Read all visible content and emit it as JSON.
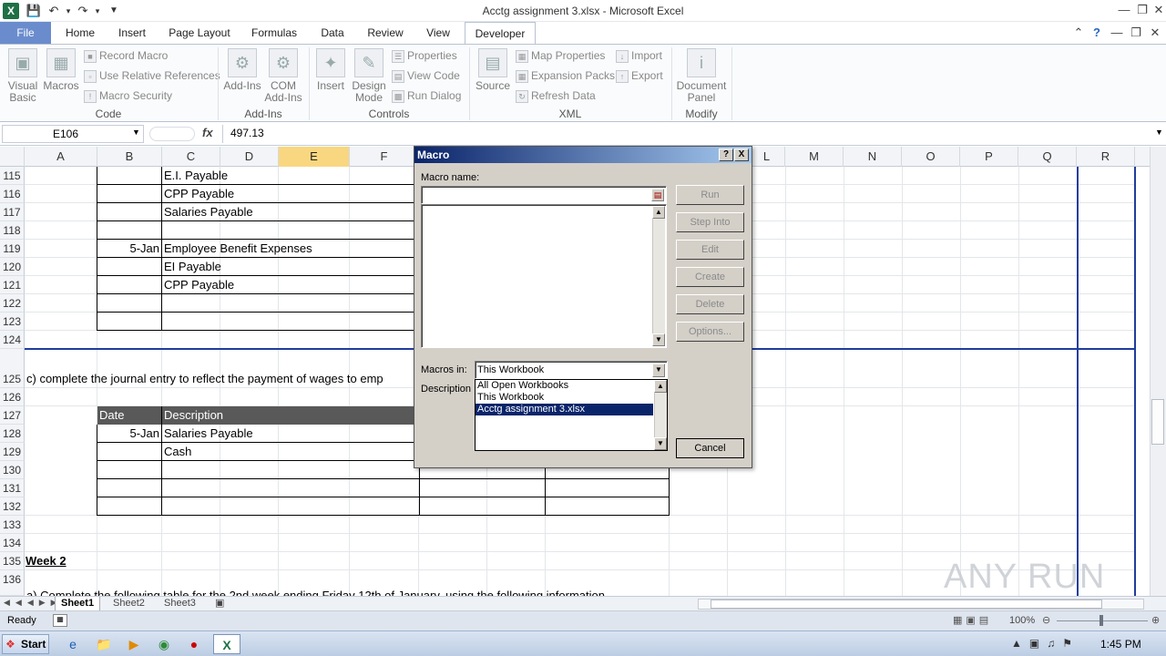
{
  "window": {
    "title": "Acctg assignment 3.xlsx - Microsoft Excel"
  },
  "ribbon": {
    "tabs": [
      "File",
      "Home",
      "Insert",
      "Page Layout",
      "Formulas",
      "Data",
      "Review",
      "View",
      "Developer"
    ],
    "active_tab": "Developer",
    "groups": {
      "code": {
        "label": "Code",
        "visual_basic": "Visual Basic",
        "macros": "Macros",
        "record_macro": "Record Macro",
        "use_relative": "Use Relative References",
        "macro_security": "Macro Security"
      },
      "addins": {
        "label": "Add-Ins",
        "addins": "Add-Ins",
        "com_addins": "COM Add-Ins"
      },
      "controls": {
        "label": "Controls",
        "insert": "Insert",
        "design_mode": "Design Mode",
        "properties": "Properties",
        "view_code": "View Code",
        "run_dialog": "Run Dialog"
      },
      "xml": {
        "label": "XML",
        "source": "Source",
        "map_properties": "Map Properties",
        "expansion_packs": "Expansion Packs",
        "refresh_data": "Refresh Data",
        "import": "Import",
        "export": "Export"
      },
      "modify": {
        "label": "Modify",
        "document_panel": "Document Panel"
      }
    }
  },
  "formula_bar": {
    "name_box": "E106",
    "fx": "fx",
    "value": "497.13"
  },
  "grid": {
    "columns": [
      "A",
      "B",
      "C",
      "D",
      "E",
      "F",
      "L",
      "M",
      "N",
      "O",
      "P",
      "Q",
      "R"
    ],
    "selected_column": "E",
    "rows": [
      "115",
      "116",
      "117",
      "118",
      "119",
      "120",
      "121",
      "122",
      "123",
      "124",
      "125",
      "126",
      "127",
      "128",
      "129",
      "130",
      "131",
      "132",
      "133",
      "134",
      "135",
      "136"
    ],
    "cells": {
      "r115_c": "E.I. Payable",
      "r116_c": "CPP Payable",
      "r117_c": "Salaries Payable",
      "r119_b": "5-Jan",
      "r119_c": "Employee Benefit Expenses",
      "r120_c": "EI Payable",
      "r121_c": "CPP Payable",
      "r125_a": "c) complete the journal entry to reflect the payment of wages to emp",
      "r127_b": "Date",
      "r127_c": "Description",
      "r128_b": "5-Jan",
      "r128_c": "Salaries Payable",
      "r129_c": "Cash",
      "r135_a": "Week 2",
      "r136_a": "a) Complete the following table for the 2nd week ending Friday 12th of January, using the following information"
    }
  },
  "sheets": [
    "Sheet1",
    "Sheet2",
    "Sheet3"
  ],
  "active_sheet": "Sheet1",
  "status": {
    "ready": "Ready",
    "zoom": "100%"
  },
  "taskbar": {
    "start": "Start",
    "time": "1:45 PM"
  },
  "dialog": {
    "title": "Macro",
    "help": "?",
    "close": "X",
    "macro_name_label": "Macro name:",
    "macro_name_value": "",
    "macros_in_label": "Macros in:",
    "macros_in_value": "This Workbook",
    "macros_in_options": [
      "All Open Workbooks",
      "This Workbook",
      "Acctg assignment 3.xlsx"
    ],
    "macros_in_highlighted": "Acctg assignment 3.xlsx",
    "description_label": "Description",
    "buttons": {
      "run": "Run",
      "step_into": "Step Into",
      "edit": "Edit",
      "create": "Create",
      "delete": "Delete",
      "options": "Options...",
      "cancel": "Cancel"
    }
  },
  "watermark": "ANY RUN"
}
